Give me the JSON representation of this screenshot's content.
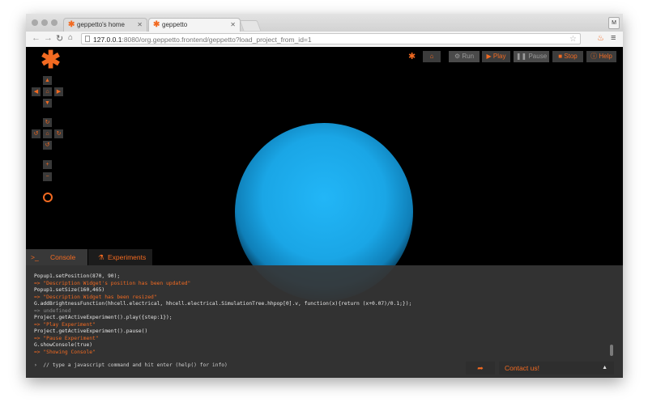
{
  "browser": {
    "tabs": [
      {
        "title": "geppetto's home",
        "active": false
      },
      {
        "title": "geppetto",
        "active": true
      }
    ],
    "profile_initial": "M",
    "url_host": "127.0.0.1",
    "url_rest": ":8080/org.geppetto.frontend/geppetto?load_project_from_id=1"
  },
  "toolbar": {
    "run": "Run",
    "play": "Play",
    "pause": "Pause",
    "stop": "Stop",
    "help": "Help"
  },
  "console": {
    "tab_console": "Console",
    "tab_experiments": "Experiments",
    "lines": [
      {
        "text": "Popup1.setPosition(870, 90);",
        "type": "cmd"
      },
      {
        "text": "=> \"Description Widget's position has been updated\"",
        "type": "out"
      },
      {
        "text": "Popup1.setSize(160,465)",
        "type": "cmd"
      },
      {
        "text": "=> \"Description Widget has been resized\"",
        "type": "out"
      },
      {
        "text": "G.addBrightnessFunction(hhcell.electrical, hhcell.electrical.SimulationTree.hhpop[0].v, function(x){return (x+0.07)/0.1;});",
        "type": "cmd"
      },
      {
        "text": "=> undefined",
        "type": "undef"
      },
      {
        "text": "Project.getActiveExperiment().play({step:1});",
        "type": "cmd"
      },
      {
        "text": "=> \"Play Experiment\"",
        "type": "out"
      },
      {
        "text": "Project.getActiveExperiment().pause()",
        "type": "cmd"
      },
      {
        "text": "=> \"Pause Experiment\"",
        "type": "out"
      },
      {
        "text": "G.showConsole(true)",
        "type": "cmd"
      },
      {
        "text": "=> \"Showing Console\"",
        "type": "out"
      }
    ],
    "placeholder": "// type a javascript command and hit enter (help() for info)",
    "contact_label": "Contact us!"
  },
  "colors": {
    "accent": "#f26a21",
    "sphere": "#1aa6e6",
    "console_bg": "#363636"
  }
}
